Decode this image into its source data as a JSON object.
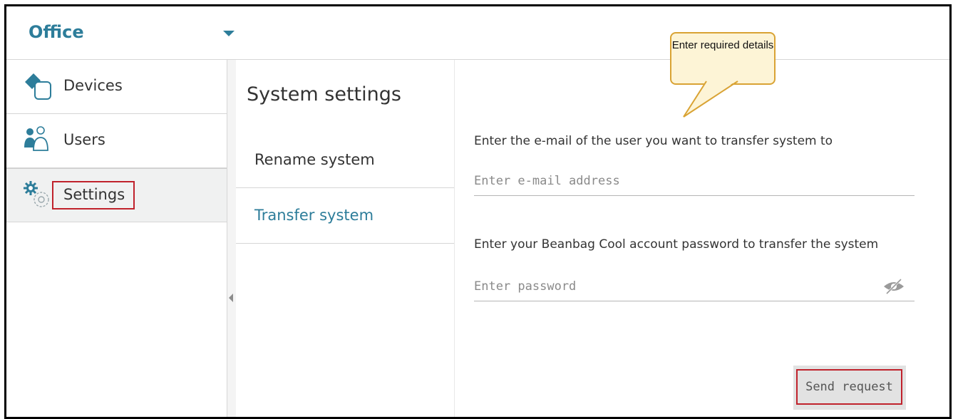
{
  "header": {
    "site_name": "Office",
    "dropdown_icon": "chevron-down-icon",
    "accent_color": "#2d7d9a"
  },
  "sidebar": {
    "items": [
      {
        "label": "Devices",
        "icon": "devices-icon"
      },
      {
        "label": "Users",
        "icon": "users-icon"
      },
      {
        "label": "Settings",
        "icon": "settings-gear-icon",
        "active": true
      }
    ]
  },
  "settings_panel": {
    "title": "System settings",
    "items": [
      {
        "label": "Rename system"
      },
      {
        "label": "Transfer system",
        "selected": true
      }
    ]
  },
  "transfer_form": {
    "email_label": "Enter the e-mail of the user you want to transfer system to",
    "email_placeholder": "Enter e-mail address",
    "password_label": "Enter your Beanbag Cool account password to transfer the system",
    "password_placeholder": "Enter password",
    "password_toggle_icon": "eye-slash-icon",
    "submit_label": "Send request"
  },
  "callout": {
    "text": "Enter required details"
  },
  "highlight_color": "#c0222c"
}
